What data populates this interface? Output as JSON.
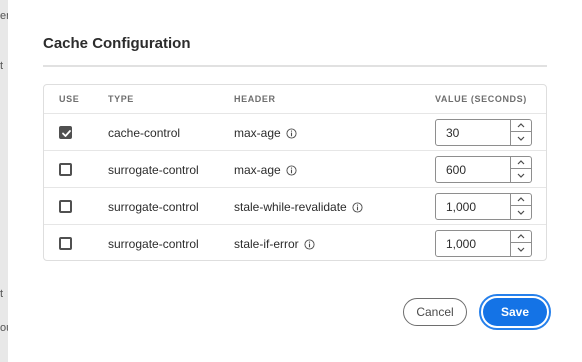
{
  "background": {
    "fragments": [
      "em",
      "t",
      "t",
      "ou"
    ]
  },
  "dialog": {
    "title": "Cache Configuration",
    "columns": {
      "use": "USE",
      "type": "TYPE",
      "header": "HEADER",
      "value": "VALUE (SECONDS)"
    },
    "rows": [
      {
        "checked": true,
        "type": "cache-control",
        "header": "max-age",
        "value": "30"
      },
      {
        "checked": false,
        "type": "surrogate-control",
        "header": "max-age",
        "value": "600"
      },
      {
        "checked": false,
        "type": "surrogate-control",
        "header": "stale-while-revalidate",
        "value": "1,000"
      },
      {
        "checked": false,
        "type": "surrogate-control",
        "header": "stale-if-error",
        "value": "1,000"
      }
    ],
    "buttons": {
      "cancel": "Cancel",
      "save": "Save"
    }
  },
  "colors": {
    "accent": "#1473e6",
    "focus_ring": "#2680eb",
    "checkbox": "#505050"
  },
  "icons": {
    "header_info": "info-icon",
    "step_up": "chevron-up-icon",
    "step_down": "chevron-down-icon",
    "checkmark": "checkmark-icon"
  }
}
